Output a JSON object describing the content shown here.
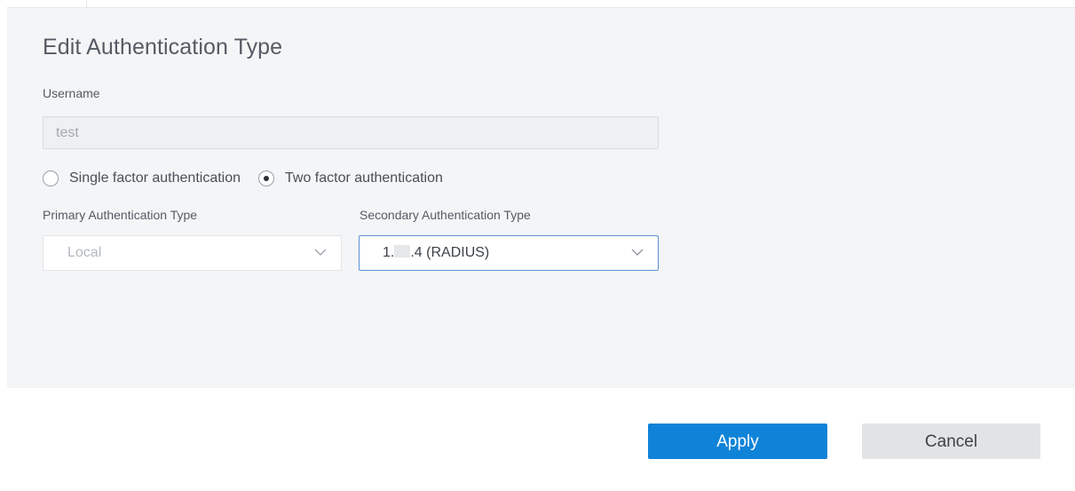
{
  "dialog": {
    "title": "Edit Authentication Type"
  },
  "username": {
    "label": "Username",
    "value": "test"
  },
  "auth_mode": {
    "options": [
      {
        "label": "Single factor authentication",
        "selected": false
      },
      {
        "label": "Two factor authentication",
        "selected": true
      }
    ]
  },
  "primary": {
    "label": "Primary Authentication Type",
    "value": "Local"
  },
  "secondary": {
    "label": "Secondary Authentication Type",
    "value_prefix": "1.",
    "value_suffix": ".4 (RADIUS)"
  },
  "footer": {
    "apply_label": "Apply",
    "cancel_label": "Cancel"
  },
  "colors": {
    "accent": "#0f83d8",
    "focus_border": "#5b8fd1",
    "panel_bg": "#f4f5f7"
  },
  "icons": {
    "select_chevron": "chevron-down-icon"
  }
}
